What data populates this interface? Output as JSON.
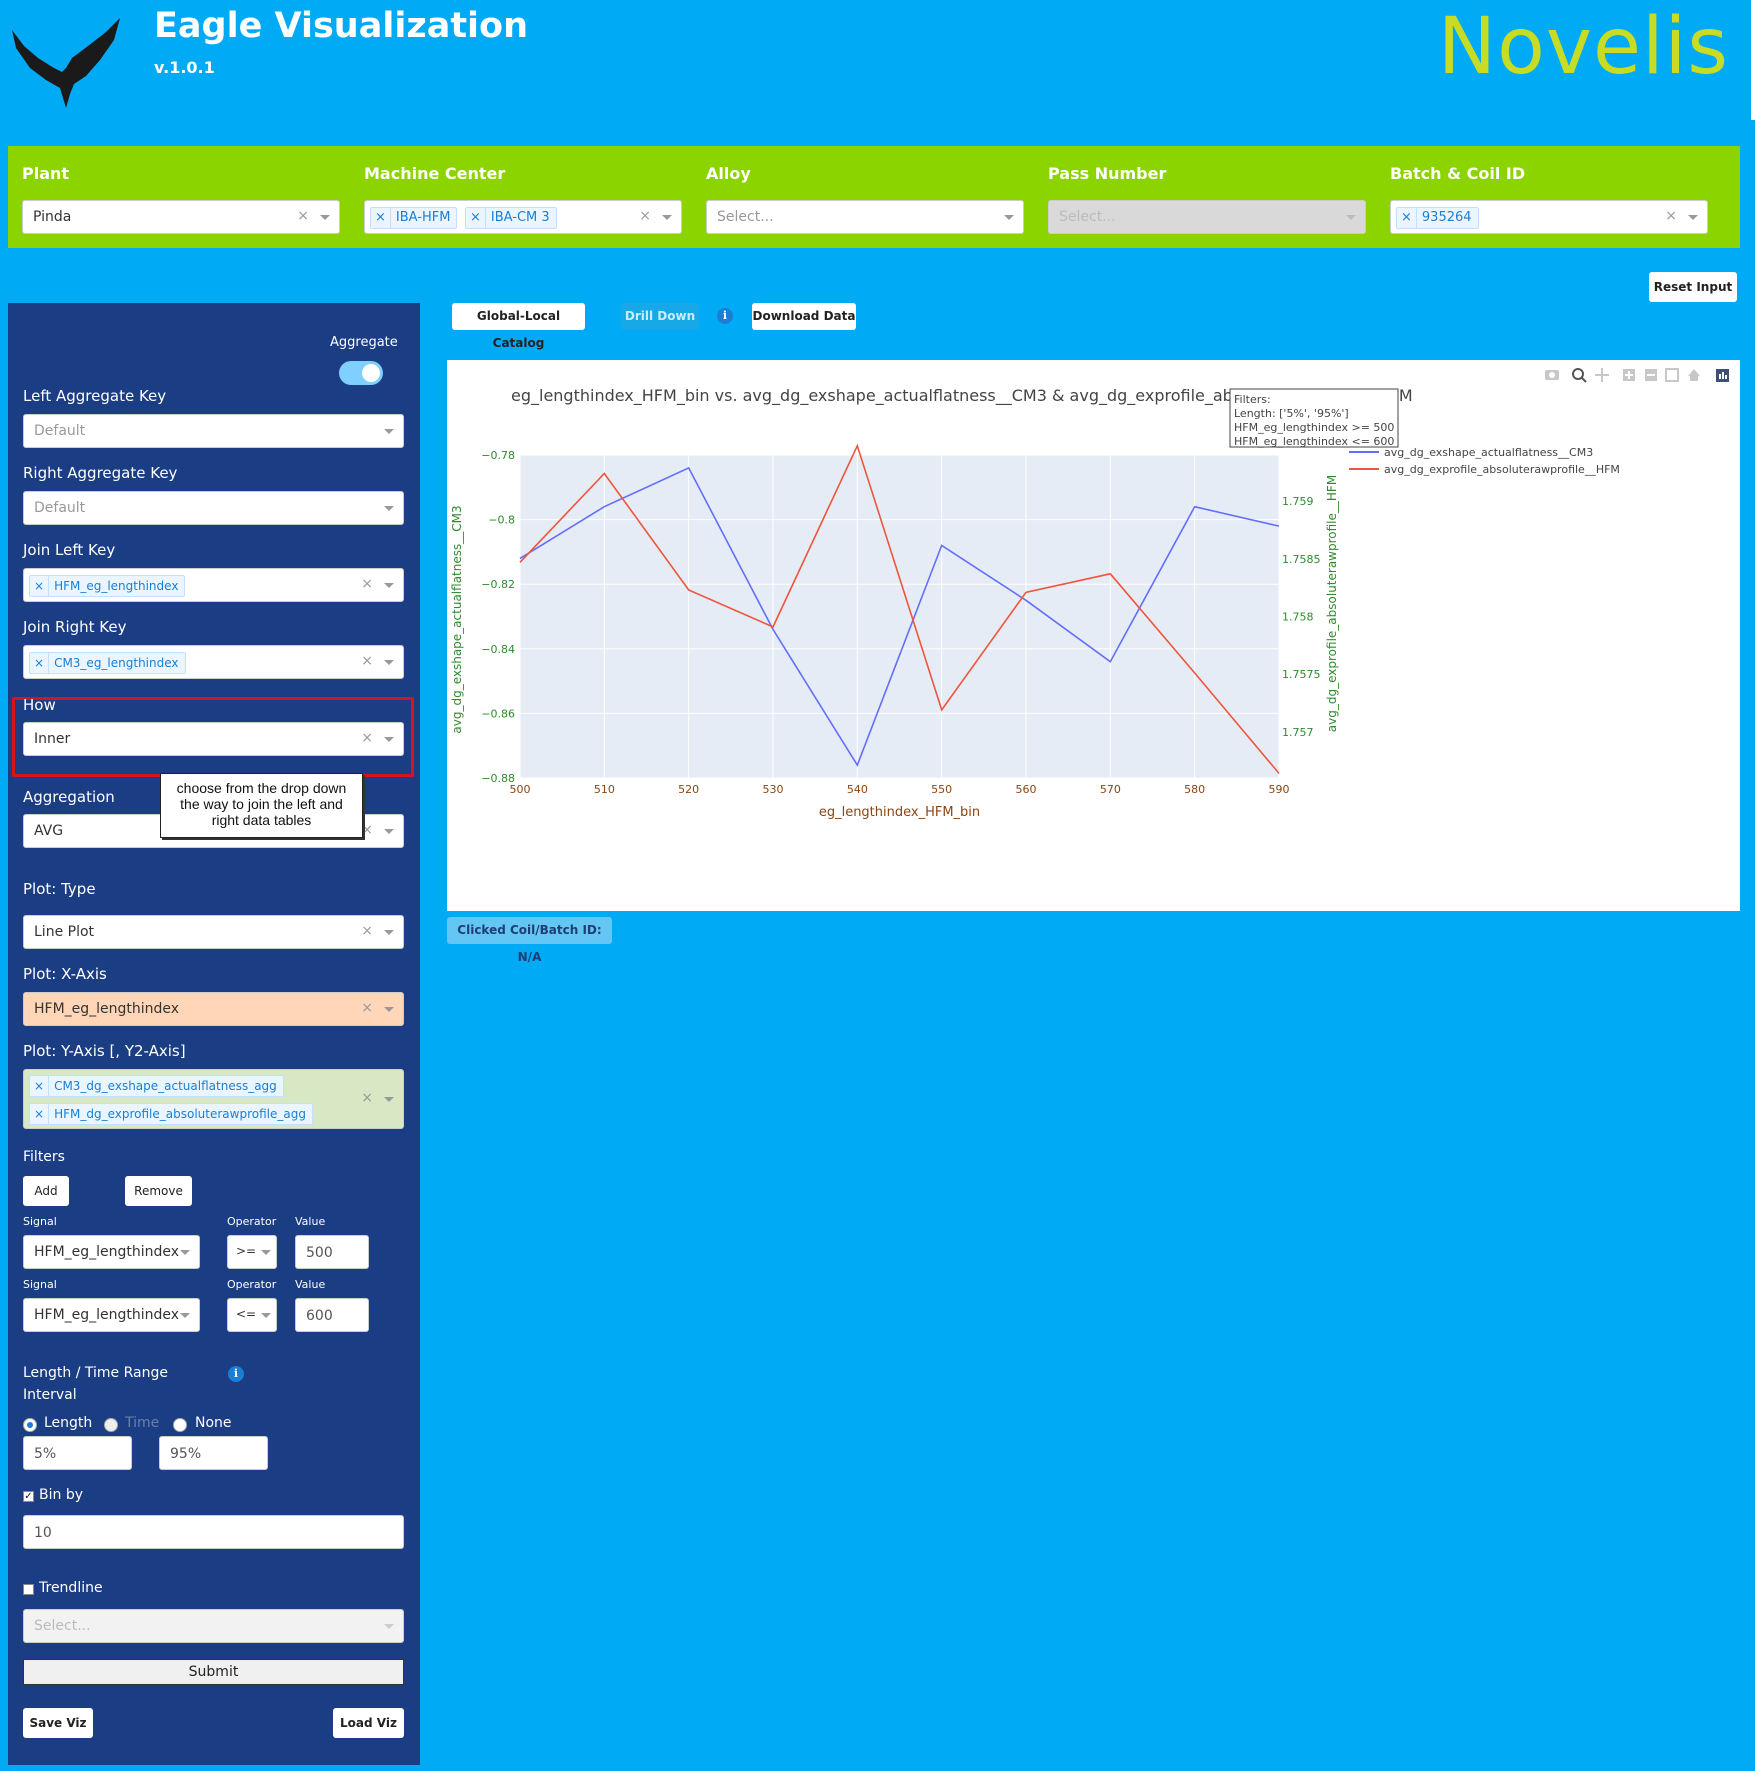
{
  "header": {
    "title": "Eagle Visualization",
    "version": "v.1.0.1",
    "brand": "Novelis"
  },
  "filters": {
    "plant": {
      "label": "Plant",
      "value": "Pinda"
    },
    "machine_center": {
      "label": "Machine Center",
      "tags": [
        "IBA-HFM",
        "IBA-CM 3"
      ]
    },
    "alloy": {
      "label": "Alloy",
      "placeholder": "Select..."
    },
    "pass_number": {
      "label": "Pass Number",
      "placeholder": "Select..."
    },
    "batch_coil": {
      "label": "Batch & Coil ID",
      "tags": [
        "935264"
      ]
    }
  },
  "reset_label": "Reset Input",
  "panel": {
    "aggregate_label": "Aggregate",
    "aggregate_on": true,
    "left_key": {
      "label": "Left Aggregate Key",
      "value": "Default"
    },
    "right_key": {
      "label": "Right Aggregate Key",
      "value": "Default"
    },
    "join_left": {
      "label": "Join Left Key",
      "tag": "HFM_eg_lengthindex"
    },
    "join_right": {
      "label": "Join Right Key",
      "tag": "CM3_eg_lengthindex"
    },
    "how": {
      "label": "How",
      "value": "Inner"
    },
    "aggregation": {
      "label": "Aggregation",
      "value": "AVG"
    },
    "plot_type": {
      "label": "Plot: Type",
      "value": "Line Plot"
    },
    "x_axis": {
      "label": "Plot: X-Axis",
      "value": "HFM_eg_lengthindex"
    },
    "y_axis": {
      "label": "Plot: Y-Axis [, Y2-Axis]",
      "tags": [
        "CM3_dg_exshape_actualflatness_agg",
        "HFM_dg_exprofile_absoluterawprofile_agg"
      ]
    },
    "filters_label": "Filters",
    "add_label": "Add",
    "remove_label": "Remove",
    "signal_label": "Signal",
    "operator_label": "Operator",
    "value_label": "Value",
    "filter_rows": [
      {
        "signal": "HFM_eg_lengthindex",
        "operator": ">=",
        "value": "500"
      },
      {
        "signal": "HFM_eg_lengthindex",
        "operator": "<=",
        "value": "600"
      }
    ],
    "range_label": "Length / Time Range Interval",
    "range_label_1": "Length / Time Range",
    "range_label_2": "Interval",
    "radio_length": "Length",
    "radio_time": "Time",
    "radio_none": "None",
    "range_from": "5%",
    "range_to": "95%",
    "bin_by_label": "Bin by",
    "bin_by_checked": true,
    "bin_value": "10",
    "trendline_label": "Trendline",
    "trendline_checked": false,
    "trendline_placeholder": "Select...",
    "submit_label": "Submit",
    "save_label": "Save Viz",
    "load_label": "Load Viz"
  },
  "callout": {
    "line1": "choose from the drop down",
    "line2": "the way to join the left and",
    "line3": "right data tables"
  },
  "toolbar": {
    "catalog_label": "Global-Local Catalog",
    "drilldown_label": "Drill Down",
    "download_label": "Download Data"
  },
  "clicked_label": "Clicked Coil/Batch ID: N/A",
  "colors": {
    "series1": "#636efa",
    "series2": "#ef553b",
    "axis_green": "#2e8b2e",
    "tick_brown": "#8b4513",
    "plot_bg": "#e5ecf6"
  },
  "chart_data": {
    "type": "line",
    "title": "eg_lengthindex_HFM_bin vs. avg_dg_exshape_actualflatness__CM3 & avg_dg_exprofile_absoluterawprofile__HFM",
    "xlabel": "eg_lengthindex_HFM_bin",
    "ylabel": "avg_dg_exshape_actualflatness__CM3",
    "y2label": "avg_dg_exprofile_absoluterawprofile__HFM",
    "x": [
      500,
      510,
      520,
      530,
      540,
      550,
      560,
      570,
      580,
      590
    ],
    "xlim": [
      500,
      590
    ],
    "ylim": [
      -0.88,
      -0.78
    ],
    "y2lim": [
      1.7566,
      1.7594
    ],
    "x_ticks": [
      "500",
      "510",
      "520",
      "530",
      "540",
      "550",
      "560",
      "570",
      "580",
      "590"
    ],
    "y_ticks": [
      "−0.78",
      "−0.8",
      "−0.82",
      "−0.84",
      "−0.86",
      "−0.88"
    ],
    "y_tick_values": [
      -0.78,
      -0.8,
      -0.82,
      -0.84,
      -0.86,
      -0.88
    ],
    "y2_ticks": [
      "1.759",
      "1.7585",
      "1.758",
      "1.7575",
      "1.757"
    ],
    "y2_tick_values": [
      1.759,
      1.7585,
      1.758,
      1.7575,
      1.757
    ],
    "series": [
      {
        "name": "avg_dg_exshape_actualflatness__CM3",
        "axis": "y",
        "values": [
          -0.812,
          -0.796,
          -0.784,
          -0.834,
          -0.876,
          -0.808,
          -0.825,
          -0.844,
          -0.796,
          -0.802
        ]
      },
      {
        "name": "avg_dg_exprofile_absoluterawprofile__HFM",
        "axis": "y2",
        "values": [
          1.75847,
          1.75924,
          1.75823,
          1.75791,
          1.75948,
          1.75719,
          1.75821,
          1.75837,
          1.75751,
          1.75664
        ]
      }
    ],
    "annotation": [
      "Filters:",
      "Length: ['5%', '95%']",
      "HFM_eg_lengthindex >= 500",
      "HFM_eg_lengthindex <= 600"
    ],
    "legend_position": "top-right",
    "grid": true
  }
}
